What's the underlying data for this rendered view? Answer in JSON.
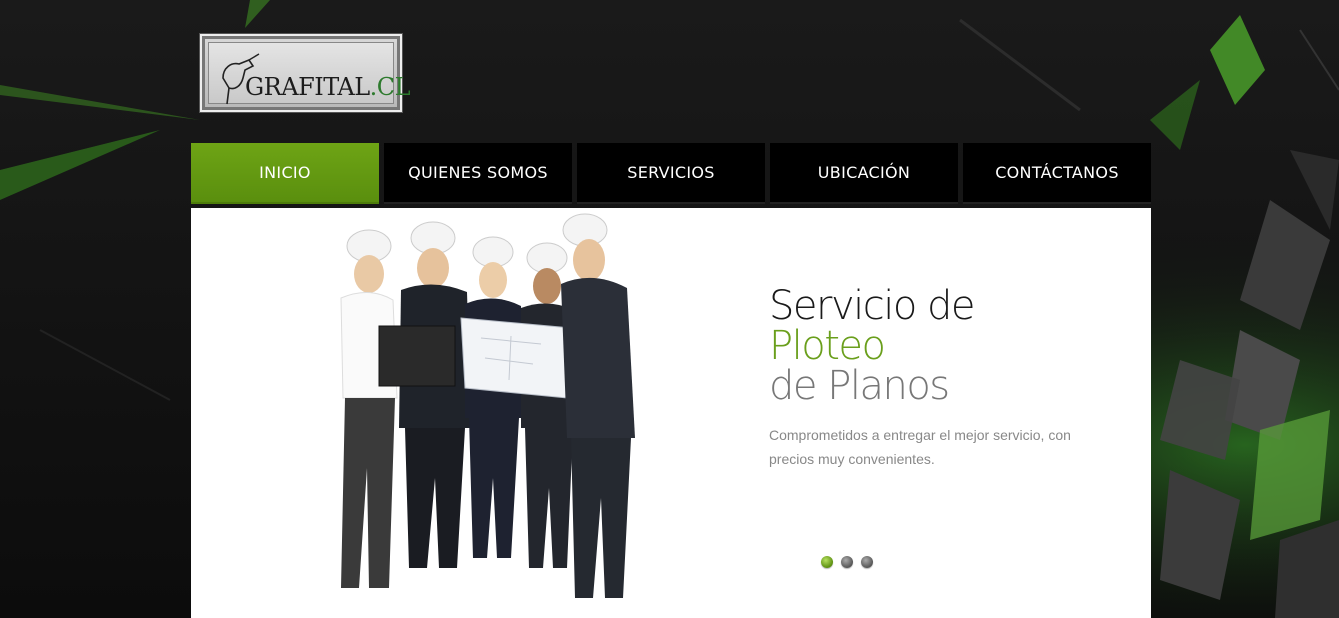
{
  "logo": {
    "text": "GRAFITAL",
    "suffix": ".CL"
  },
  "nav": {
    "items": [
      {
        "label": "INICIO",
        "active": true
      },
      {
        "label": "QUIENES SOMOS",
        "active": false
      },
      {
        "label": "SERVICIOS",
        "active": false
      },
      {
        "label": "UBICACIÓN",
        "active": false
      },
      {
        "label": "CONTÁCTANOS",
        "active": false
      }
    ]
  },
  "slide": {
    "line1": "Servicio de",
    "line2": "Ploteo",
    "line3": "de Planos",
    "description": "Comprometidos a entregar el mejor servicio, con precios muy convenientes.",
    "current": 1,
    "total": 3
  },
  "colors": {
    "accent": "#6a9f1c",
    "nav_bg": "#000000",
    "background": "#111111"
  }
}
